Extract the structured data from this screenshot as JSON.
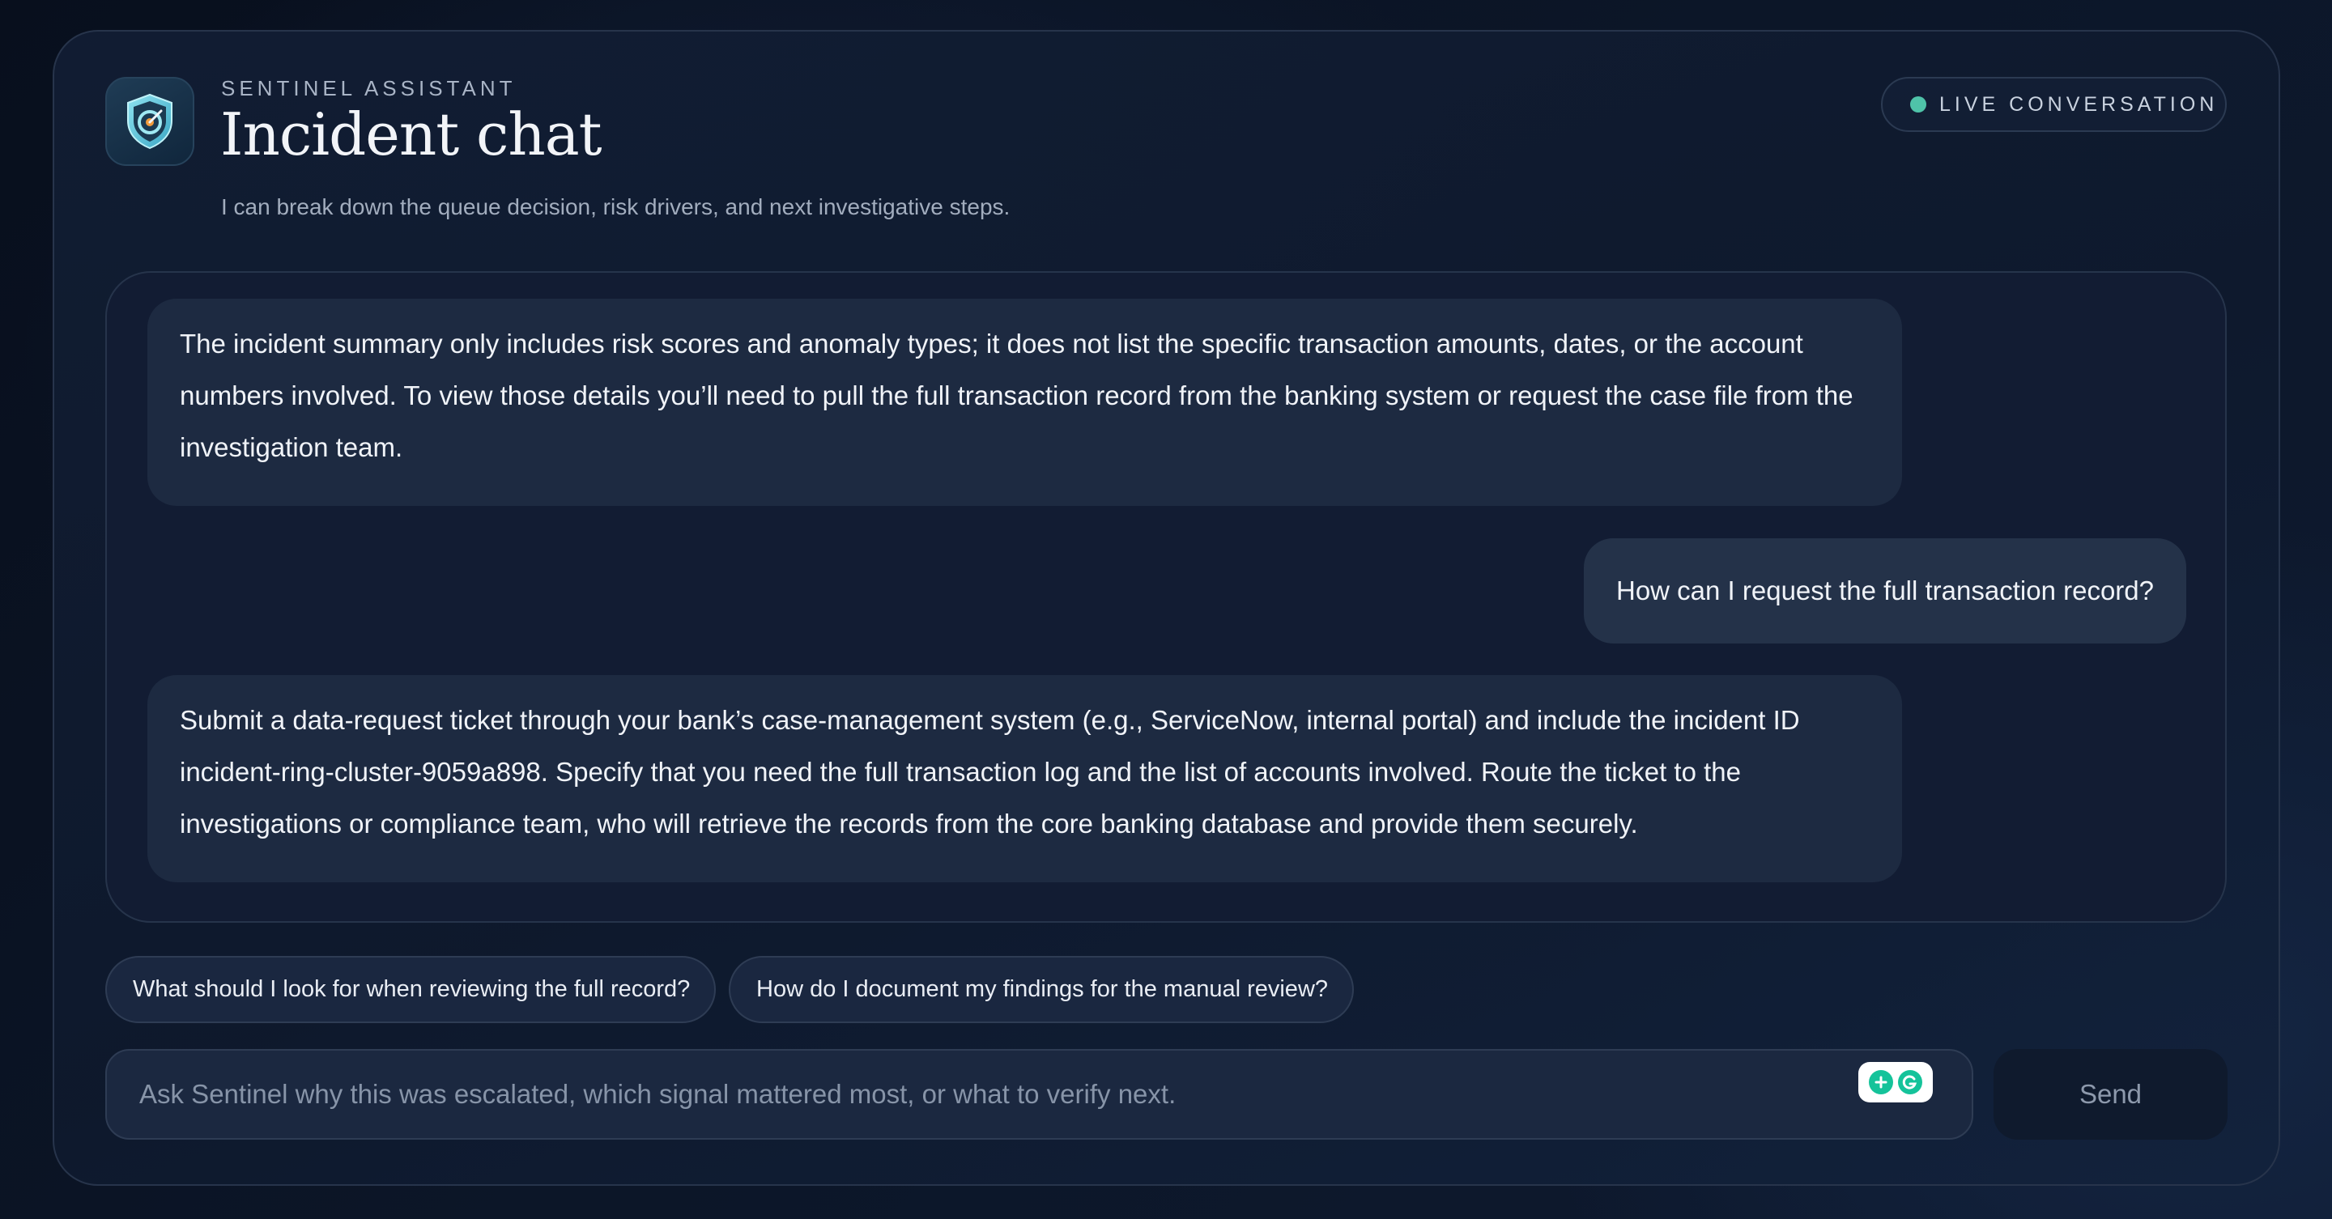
{
  "header": {
    "eyebrow": "SENTINEL ASSISTANT",
    "title": "Incident chat",
    "subtitle": "I can break down the queue decision, risk drivers, and next investigative steps.",
    "logo_icon": "shield-target-icon",
    "status_badge": "LIVE CONVERSATION",
    "status_color": "#4fc3a9"
  },
  "messages": [
    {
      "role": "assistant",
      "text": "The incident summary only includes risk scores and anomaly types; it does not list the specific transaction amounts, dates, or the account numbers involved. To view those details you’ll need to pull the full transaction record from the banking system or request the case file from the investigation team."
    },
    {
      "role": "user",
      "text": "How can I request the full transaction record?"
    },
    {
      "role": "assistant",
      "text": "Submit a data-request ticket through your bank’s case-management system (e.g., ServiceNow, internal portal) and include the incident ID incident-ring-cluster-9059a898. Specify that you need the full transaction log and the list of accounts involved. Route the ticket to the investigations or compliance team, who will retrieve the records from the core banking database and provide them securely."
    }
  ],
  "suggestions": [
    "What should I look for when reviewing the full record?",
    "How do I document my findings for the manual review?"
  ],
  "composer": {
    "placeholder": "Ask Sentinel why this was escalated, which signal mattered most, or what to verify next.",
    "value": "",
    "send_label": "Send",
    "widget_icon": "grammar-assistant-icon"
  },
  "colors": {
    "accent": "#4fc3a9",
    "background": "#0b1426",
    "panel_border": "#27344b",
    "assistant_bubble": "#1d2a41",
    "user_bubble": "#243249"
  }
}
